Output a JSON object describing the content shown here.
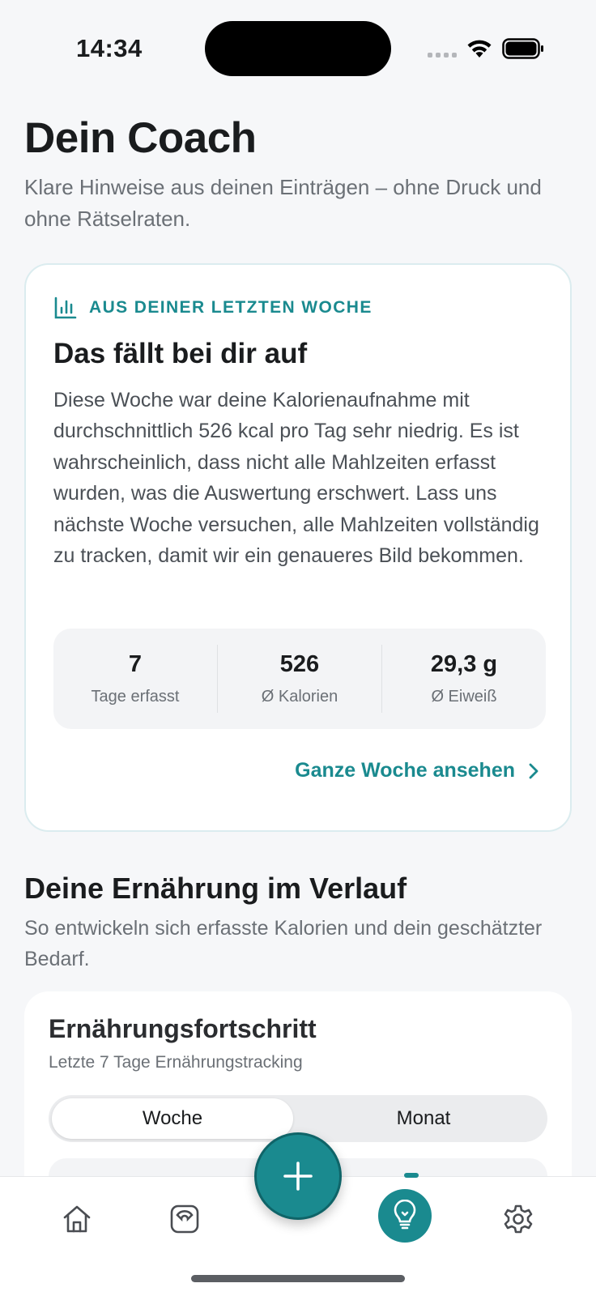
{
  "status_bar": {
    "time": "14:34"
  },
  "header": {
    "title": "Dein Coach",
    "subtitle": "Klare Hinweise aus deinen Einträgen – ohne Druck und ohne Rätselraten."
  },
  "insight_card": {
    "eyebrow": "AUS DEINER LETZTEN WOCHE",
    "title": "Das fällt bei dir auf",
    "body": "Diese Woche war deine Kalorienaufnahme mit durchschnittlich 526 kcal pro Tag sehr niedrig. Es ist wahrscheinlich, dass nicht alle Mahlzeiten erfasst wurden, was die Auswertung erschwert. Lass uns nächste Woche versuchen, alle Mahlzeiten vollständig zu tracken, damit wir ein genaueres Bild bekommen.",
    "stats": [
      {
        "value": "7",
        "label": "Tage erfasst"
      },
      {
        "value": "526",
        "label": "Ø Kalorien"
      },
      {
        "value": "29,3 g",
        "label": "Ø Eiweiß"
      }
    ],
    "link_label": "Ganze Woche ansehen"
  },
  "nutrition_section": {
    "title": "Deine Ernährung im Verlauf",
    "subtitle": "So entwickeln sich erfasste Kalorien und dein geschätzter Bedarf."
  },
  "progress_card": {
    "title": "Ernährungsfortschritt",
    "subtitle": "Letzte 7 Tage Ernährungstracking",
    "segments": [
      "Woche",
      "Monat"
    ],
    "selected_segment": "Woche"
  },
  "tab_bar": {
    "tabs": [
      {
        "icon": "home-icon"
      },
      {
        "icon": "scale-icon"
      },
      {
        "icon": "lightbulb-icon",
        "active": true
      },
      {
        "icon": "gear-icon"
      }
    ],
    "fab_icon": "plus-icon"
  },
  "colors": {
    "accent": "#1a8a8f",
    "background": "#f6f7f9",
    "card": "#ffffff",
    "muted_text": "#6b7076"
  }
}
